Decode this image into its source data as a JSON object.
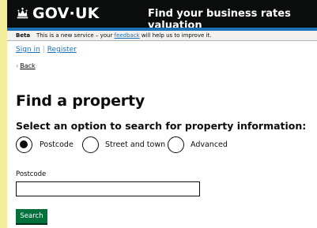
{
  "header": {
    "logo_text": "GOV·UK",
    "logo_icon": "crown-icon",
    "service_name": "Find your business rates valuation"
  },
  "beta_banner": {
    "tag": "Beta",
    "message_prefix": "This is a new service – your ",
    "feedback_link": "feedback",
    "message_suffix": " will help us to improve it."
  },
  "account": {
    "sign_in": "Sign in",
    "separator": "|",
    "register": "Register"
  },
  "back": {
    "label": "Back"
  },
  "page": {
    "title": "Find a property",
    "legend": "Select an option to search for property information:"
  },
  "radios": [
    {
      "label": "Postcode",
      "selected": true
    },
    {
      "label": "Street and town",
      "selected": false
    },
    {
      "label": "Advanced",
      "selected": false
    }
  ],
  "postcode": {
    "label": "Postcode",
    "value": ""
  },
  "search_button": {
    "label": "Search"
  },
  "colors": {
    "header_bg": "#0b0c0c",
    "header_rule": "#1d70b8",
    "link": "#1d70b8",
    "button": "#00703c",
    "side_highlight": "#f3ee9b"
  }
}
